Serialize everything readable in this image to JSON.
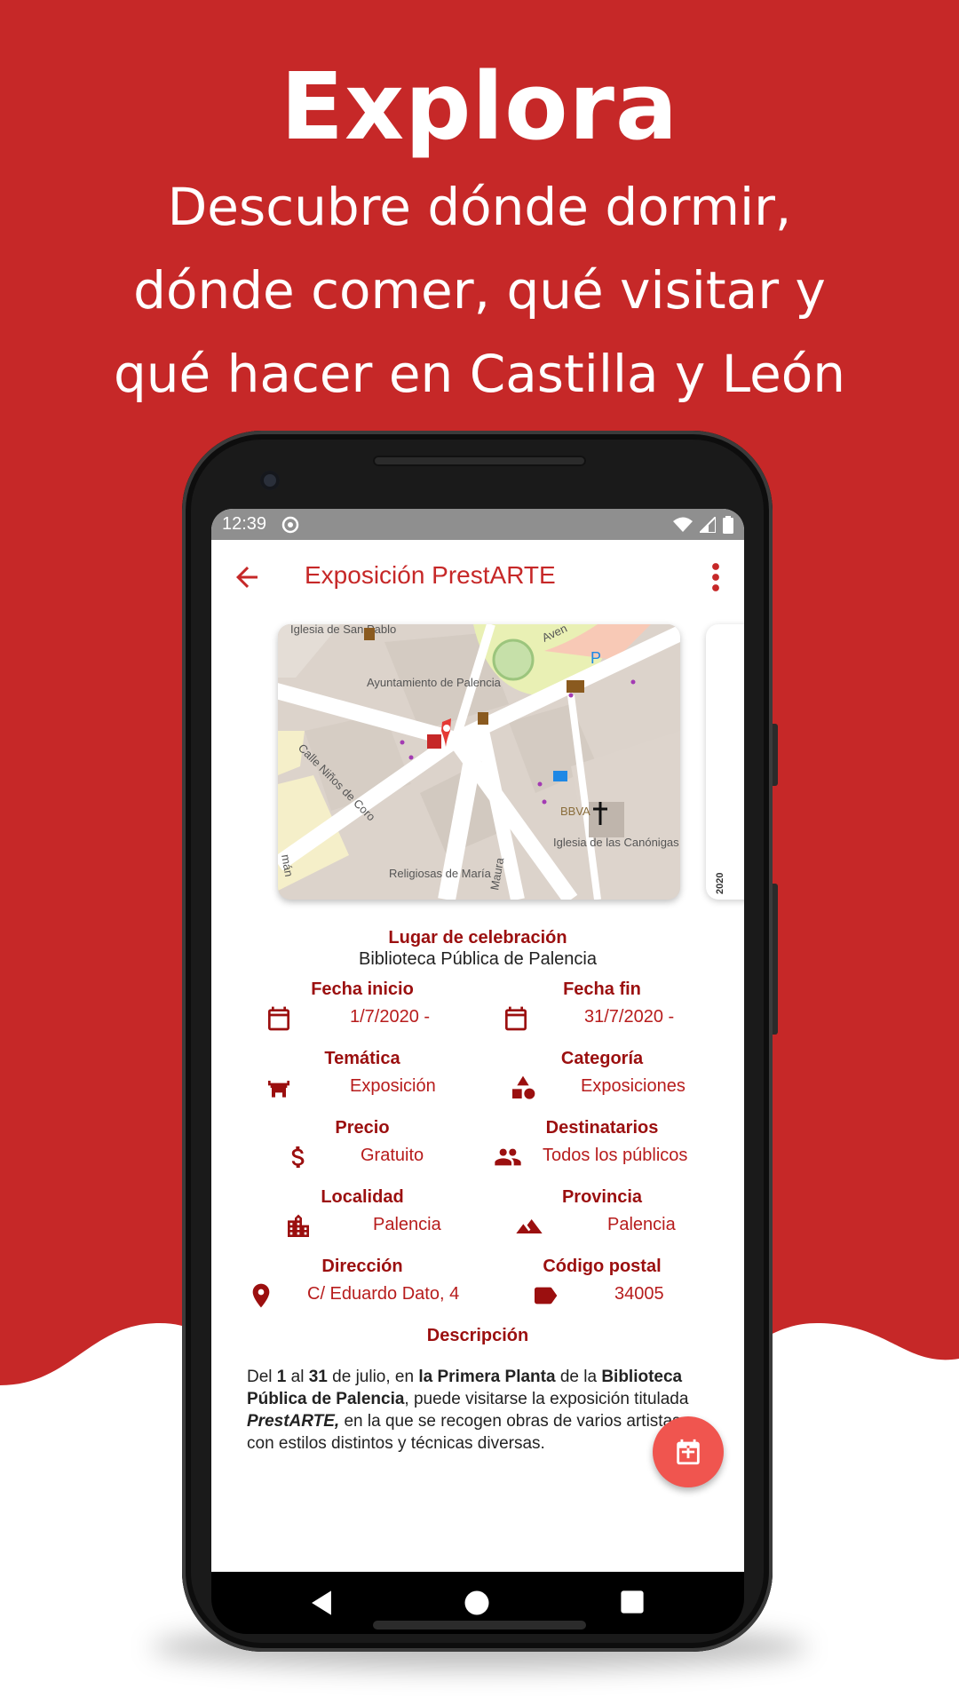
{
  "promo": {
    "title": "Explora",
    "subtitle_lines": [
      "Descubre dónde dormir,",
      "dónde comer, qué visitar y",
      "qué hacer en Castilla y León"
    ]
  },
  "status_bar": {
    "time": "12:39"
  },
  "app_bar": {
    "title": "Exposición PrestARTE"
  },
  "map": {
    "labels": [
      "Iglesia de San Pablo",
      "Ayuntamiento de Palencia",
      "Calle Niños de Coro",
      "Religiosas de María",
      "Iglesia de las Canónigas",
      "BBVA",
      "Maura",
      "Aven",
      "mán"
    ],
    "next_card_label": "2020"
  },
  "venue": {
    "label": "Lugar de celebración",
    "value": "Biblioteca Pública de Palencia"
  },
  "fields": {
    "start_date": {
      "label": "Fecha inicio",
      "value": "1/7/2020 -"
    },
    "end_date": {
      "label": "Fecha fin",
      "value": "31/7/2020 -"
    },
    "theme": {
      "label": "Temática",
      "value": "Exposición"
    },
    "category": {
      "label": "Categoría",
      "value": "Exposiciones"
    },
    "price": {
      "label": "Precio",
      "value": "Gratuito"
    },
    "audience": {
      "label": "Destinatarios",
      "value": "Todos los públicos"
    },
    "locality": {
      "label": "Localidad",
      "value": "Palencia"
    },
    "province": {
      "label": "Provincia",
      "value": "Palencia"
    },
    "address": {
      "label": "Dirección",
      "value": "C/ Eduardo Dato, 4"
    },
    "postal_code": {
      "label": "Código postal",
      "value": "34005"
    }
  },
  "description": {
    "label": "Descripción",
    "parts": [
      {
        "t": "Del ",
        "b": false,
        "i": false
      },
      {
        "t": "1",
        "b": true,
        "i": false
      },
      {
        "t": " al ",
        "b": false,
        "i": false
      },
      {
        "t": "31",
        "b": true,
        "i": false
      },
      {
        "t": " de julio, en ",
        "b": false,
        "i": false
      },
      {
        "t": "la Primera Planta",
        "b": true,
        "i": false
      },
      {
        "t": " de la ",
        "b": false,
        "i": false
      },
      {
        "t": "Biblioteca Pública de Palencia",
        "b": true,
        "i": false
      },
      {
        "t": ", puede visitarse la exposición titulada ",
        "b": false,
        "i": false
      },
      {
        "t": "PrestARTE,",
        "b": true,
        "i": true
      },
      {
        "t": " en la que se recogen obras de varios artistas con estilos distintos y técnicas diversas.",
        "b": false,
        "i": false
      }
    ]
  },
  "colors": {
    "brand_red": "#c62828",
    "label_red": "#9b0f0f",
    "fab": "#f0554f"
  },
  "icons": {
    "back": "arrow-left-icon",
    "menu": "more-vert-icon",
    "start_date": "calendar-icon",
    "end_date": "calendar-icon",
    "theme": "bridge-icon",
    "category": "shapes-icon",
    "price": "dollar-icon",
    "audience": "people-icon",
    "locality": "city-icon",
    "province": "mountains-icon",
    "address": "location-pin-icon",
    "postal_code": "label-tag-icon",
    "fab": "calendar-plus-icon"
  }
}
